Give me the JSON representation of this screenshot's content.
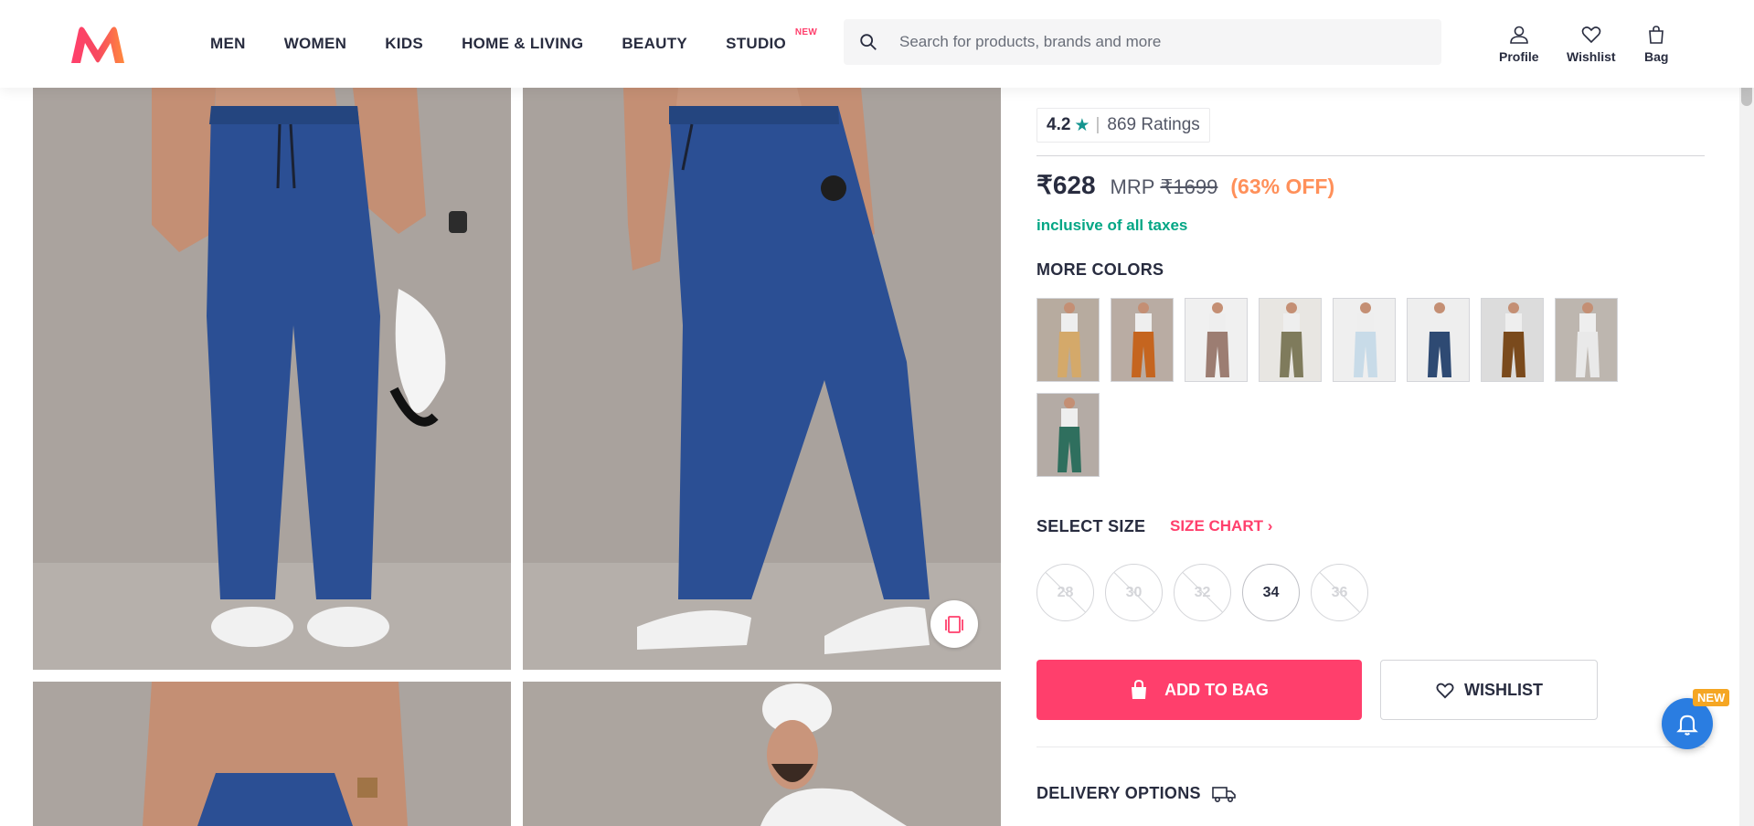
{
  "header": {
    "nav": [
      "MEN",
      "WOMEN",
      "KIDS",
      "HOME & LIVING",
      "BEAUTY",
      "STUDIO"
    ],
    "studio_badge": "NEW",
    "search_placeholder": "Search for products, brands and more",
    "profile_label": "Profile",
    "wishlist_label": "Wishlist",
    "bag_label": "Bag"
  },
  "product": {
    "rating_value": "4.2",
    "rating_count": "869 Ratings",
    "price": "₹628",
    "mrp_label": "MRP",
    "mrp": "₹1699",
    "discount": "(63% OFF)",
    "taxes_note": "inclusive of all taxes",
    "more_colors_title": "MORE COLORS",
    "color_swatches": [
      {
        "pant": "#d4a96a",
        "bg": "#b7ab9f"
      },
      {
        "pant": "#c5651f",
        "bg": "#b9aca3"
      },
      {
        "pant": "#9c7d72",
        "bg": "#f0f0f0"
      },
      {
        "pant": "#7f7b5c",
        "bg": "#e8e6e2"
      },
      {
        "pant": "#c8dbe8",
        "bg": "#efefef"
      },
      {
        "pant": "#2e4a73",
        "bg": "#eeeeee"
      },
      {
        "pant": "#7a4a1c",
        "bg": "#dcdcdc"
      },
      {
        "pant": "#e9e9e9",
        "bg": "#bdb6af"
      },
      {
        "pant": "#2f6f5e",
        "bg": "#b4aba5"
      }
    ],
    "select_size_title": "SELECT SIZE",
    "size_chart_label": "SIZE CHART",
    "sizes": [
      {
        "label": "28",
        "available": false
      },
      {
        "label": "30",
        "available": false
      },
      {
        "label": "32",
        "available": false
      },
      {
        "label": "34",
        "available": true
      },
      {
        "label": "36",
        "available": false
      }
    ],
    "add_to_bag_label": "ADD TO BAG",
    "wishlist_button_label": "WISHLIST",
    "delivery_title": "DELIVERY OPTIONS"
  },
  "notification_badge": "NEW",
  "colors": {
    "accent": "#ff3f6c",
    "discount": "#ff905a",
    "tax_green": "#03a685",
    "rating_star": "#14958f",
    "pants_blue": "#2b4f94"
  }
}
